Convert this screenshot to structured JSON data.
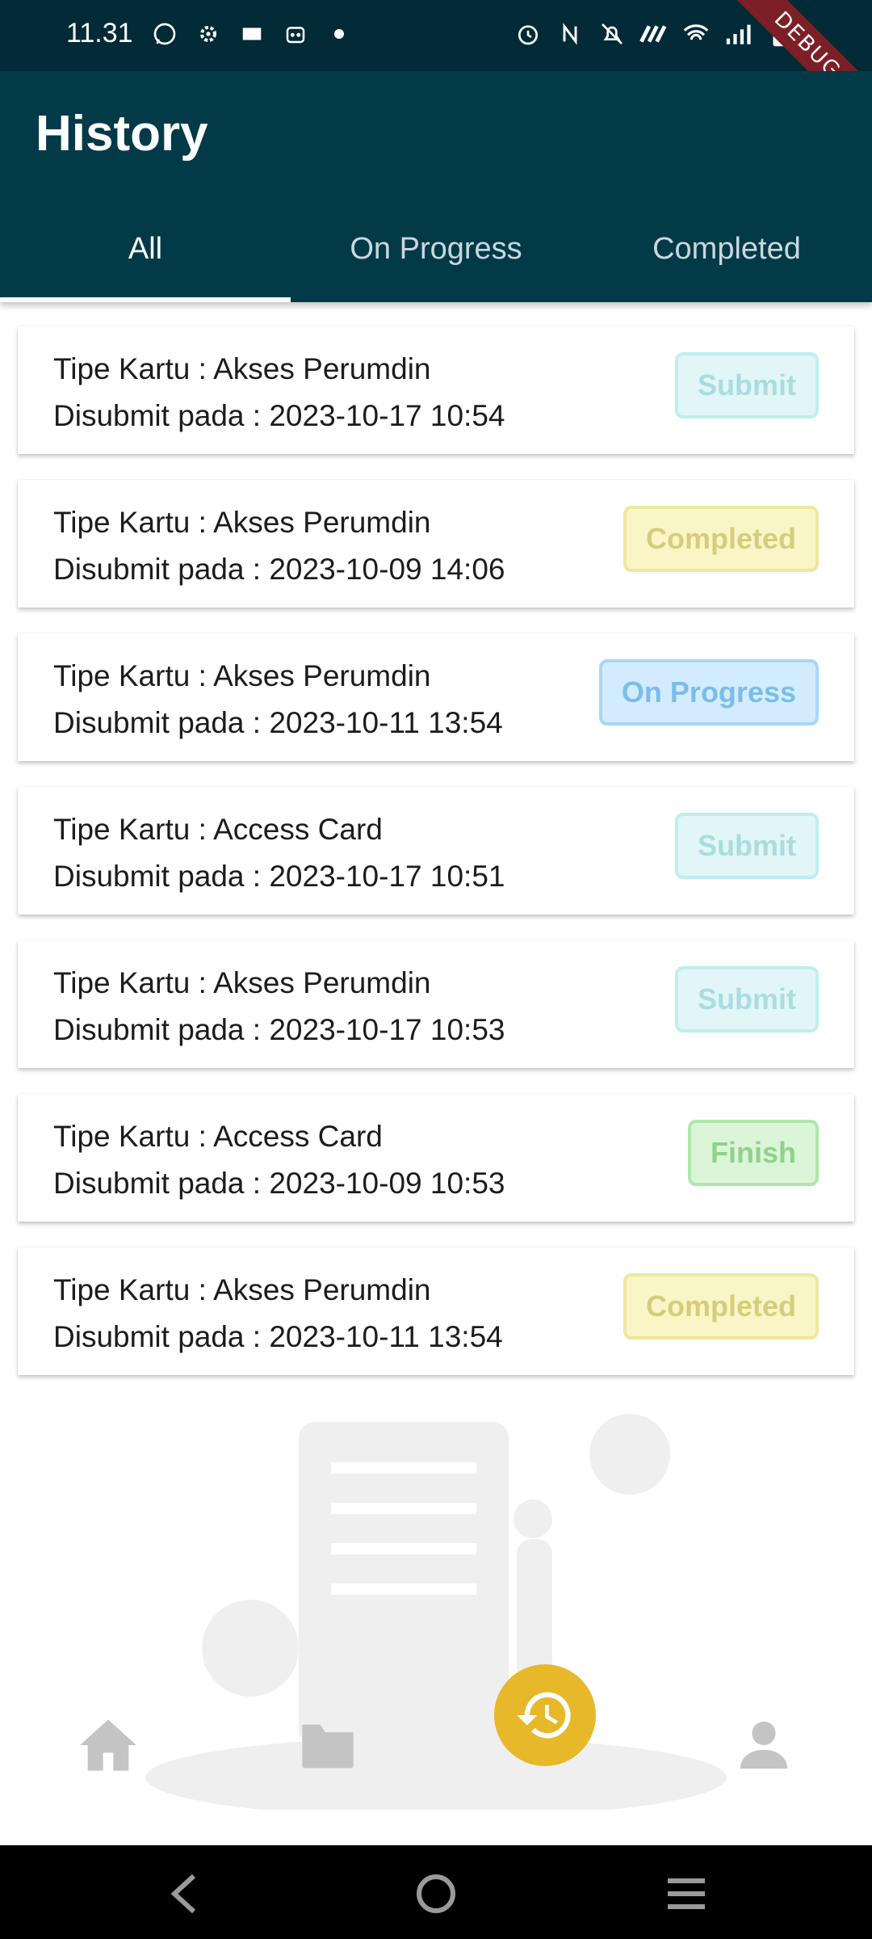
{
  "status_bar": {
    "time": "11.31",
    "left_icons": [
      "whatsapp-icon",
      "settings-icon",
      "mail-icon",
      "robot-icon",
      "dot-icon"
    ],
    "right_icons": [
      "alarm-icon",
      "nfc-icon",
      "mute-icon",
      "data-icon",
      "wifi-icon",
      "signal-icon",
      "battery-icon"
    ]
  },
  "debug_banner": "DEBUG",
  "app_bar": {
    "title": "History"
  },
  "tabs": [
    {
      "label": "All",
      "active": true
    },
    {
      "label": "On Progress",
      "active": false
    },
    {
      "label": "Completed",
      "active": false
    }
  ],
  "history": [
    {
      "type_line": "Tipe Kartu : Akses Perumdin",
      "date_line": "Disubmit pada : 2023-10-17 10:54",
      "status": "Submit",
      "status_bg": "#e2f6f7",
      "status_border": "#bfeef0",
      "status_color": "#a9dde0"
    },
    {
      "type_line": "Tipe Kartu : Akses Perumdin",
      "date_line": "Disubmit pada : 2023-10-09 14:06",
      "status": "Completed",
      "status_bg": "#f9f5c7",
      "status_border": "#efe79e",
      "status_color": "#d6cd7b"
    },
    {
      "type_line": "Tipe Kartu : Akses Perumdin",
      "date_line": "Disubmit pada : 2023-10-11 13:54",
      "status": "On Progress",
      "status_bg": "#d3ecfd",
      "status_border": "#a9d6f7",
      "status_color": "#7bbde8"
    },
    {
      "type_line": "Tipe Kartu : Access Card",
      "date_line": "Disubmit pada : 2023-10-17 10:51",
      "status": "Submit",
      "status_bg": "#e2f6f7",
      "status_border": "#bfeef0",
      "status_color": "#a9dde0"
    },
    {
      "type_line": "Tipe Kartu : Akses Perumdin",
      "date_line": "Disubmit pada : 2023-10-17 10:53",
      "status": "Submit",
      "status_bg": "#e2f6f7",
      "status_border": "#bfeef0",
      "status_color": "#a9dde0"
    },
    {
      "type_line": "Tipe Kartu : Access Card",
      "date_line": "Disubmit pada : 2023-10-09 10:53",
      "status": "Finish",
      "status_bg": "#daf5d8",
      "status_border": "#b0e6ac",
      "status_color": "#8fd28a"
    },
    {
      "type_line": "Tipe Kartu : Akses Perumdin",
      "date_line": "Disubmit pada : 2023-10-11 13:54",
      "status": "Completed",
      "status_bg": "#f9f5c7",
      "status_border": "#efe79e",
      "status_color": "#d6cd7b"
    }
  ],
  "bottom_nav": {
    "items": [
      "home-icon",
      "folder-icon",
      "history-icon",
      "person-icon"
    ],
    "active": "history-icon",
    "active_color": "#e6b82a",
    "inactive_color": "#c4c4c4"
  },
  "system_nav": [
    "back-icon",
    "home-circle-icon",
    "recents-icon"
  ]
}
